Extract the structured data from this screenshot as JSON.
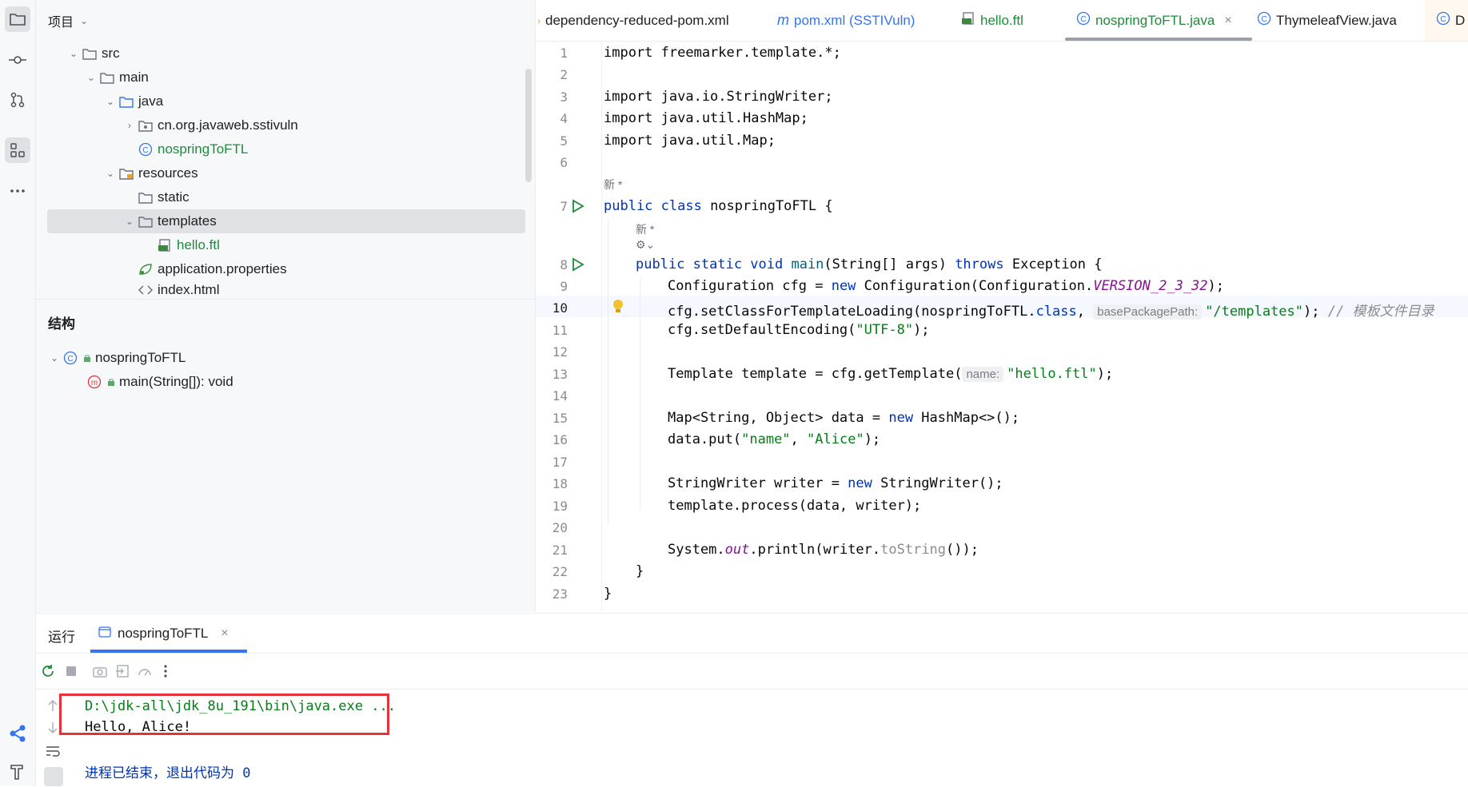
{
  "project_panel": {
    "title": "项目",
    "tree": [
      {
        "label": "src",
        "type": "folder",
        "expanded": true
      },
      {
        "label": "main",
        "type": "folder",
        "expanded": true
      },
      {
        "label": "java",
        "type": "source-folder",
        "expanded": true
      },
      {
        "label": "cn.org.javaweb.sstivuln",
        "type": "package",
        "expanded": false
      },
      {
        "label": "nospringToFTL",
        "type": "class"
      },
      {
        "label": "resources",
        "type": "resource-folder",
        "expanded": true
      },
      {
        "label": "static",
        "type": "folder"
      },
      {
        "label": "templates",
        "type": "folder",
        "expanded": true,
        "selected": true
      },
      {
        "label": "hello.ftl",
        "type": "ftl"
      },
      {
        "label": "application.properties",
        "type": "properties"
      },
      {
        "label": "index.html",
        "type": "html"
      }
    ]
  },
  "structure_panel": {
    "title": "结构",
    "items": [
      {
        "label": "nospringToFTL",
        "type": "class"
      },
      {
        "label": "main(String[]): void",
        "type": "method"
      }
    ]
  },
  "tabs": [
    {
      "label": "dependency-reduced-pom.xml",
      "icon": "xml-icon"
    },
    {
      "label": "pom.xml (SSTIVuln)",
      "icon": "maven-icon"
    },
    {
      "label": "hello.ftl",
      "icon": "ftl-icon"
    },
    {
      "label": "nospringToFTL.java",
      "icon": "class-icon",
      "active": true
    },
    {
      "label": "ThymeleafView.java",
      "icon": "class-icon"
    },
    {
      "label": "D",
      "icon": "class-icon"
    }
  ],
  "editor": {
    "line_numbers": [
      "1",
      "2",
      "3",
      "4",
      "5",
      "6",
      "7",
      "8",
      "9",
      "10",
      "11",
      "12",
      "13",
      "14",
      "15",
      "16",
      "17",
      "18",
      "19",
      "20",
      "21",
      "22",
      "23"
    ],
    "current_line": "10",
    "annotations": {
      "new_class": "新 *",
      "new_method": "新 *"
    },
    "hints": {
      "base_package_path": "basePackagePath:",
      "name": "name:"
    },
    "code": {
      "l1": "import freemarker.template.*;",
      "l3": "import java.io.StringWriter;",
      "l4": "import java.util.HashMap;",
      "l5": "import java.util.Map;",
      "l7_kw": "public class ",
      "l7_rest": "nospringToFTL {",
      "l8_kw": "public static void ",
      "l8_fn": "main",
      "l8_mid": "(String[] args) ",
      "l8_kw2": "throws ",
      "l8_rest": "Exception {",
      "l9_a": "Configuration cfg = ",
      "l9_kw": "new ",
      "l9_b": "Configuration(Configuration.",
      "l9_st": "VERSION_2_3_32",
      "l9_c": ");",
      "l10_a": "cfg.setClassForTemplateLoading(nospringToFTL.",
      "l10_kw": "class",
      "l10_b": ", ",
      "l10_str": "\"/templates\"",
      "l10_c": "); ",
      "l10_cmt": "// 模板文件目录",
      "l11_a": "cfg.setDefaultEncoding(",
      "l11_str": "\"UTF-8\"",
      "l11_b": ");",
      "l13_a": "Template template = cfg.getTemplate(",
      "l13_str": "\"hello.ftl\"",
      "l13_b": ");",
      "l15_a": "Map<String, Object> data = ",
      "l15_kw": "new ",
      "l15_b": "HashMap<>();",
      "l16_a": "data.put(",
      "l16_str1": "\"name\"",
      "l16_b": ", ",
      "l16_str2": "\"Alice\"",
      "l16_c": ");",
      "l18_a": "StringWriter writer = ",
      "l18_kw": "new ",
      "l18_b": "StringWriter();",
      "l19": "template.process(data, writer);",
      "l21_a": "System.",
      "l21_st": "out",
      "l21_b": ".println(writer.",
      "l21_fn": "toString",
      "l21_c": "());",
      "l22": "}",
      "l23": "}"
    }
  },
  "run_panel": {
    "label": "运行",
    "tab_label": "nospringToFTL",
    "output": {
      "cmd": "D:\\jdk-all\\jdk_8u_191\\bin\\java.exe ...",
      "hello": "Hello, Alice!",
      "exit": "进程已结束，退出代码为 0"
    }
  },
  "colors": {
    "keyword": "#0033b3",
    "string": "#067d17",
    "static_field": "#871094",
    "highlight_box": "#e5333b",
    "accent": "#3574f0"
  }
}
